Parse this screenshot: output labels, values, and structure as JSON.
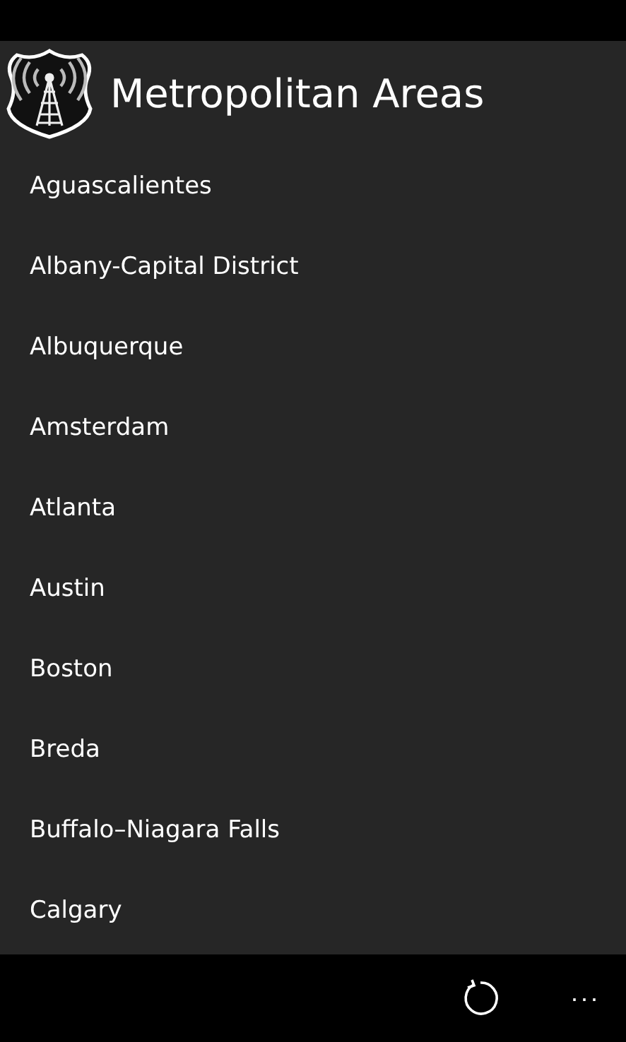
{
  "title": "Metropolitan Areas",
  "areas": [
    "Aguascalientes",
    "Albany-Capital District",
    "Albuquerque",
    "Amsterdam",
    "Atlanta",
    "Austin",
    "Boston",
    "Breda",
    "Buffalo–Niagara Falls",
    "Calgary"
  ],
  "app_bar": {
    "more": "..."
  }
}
